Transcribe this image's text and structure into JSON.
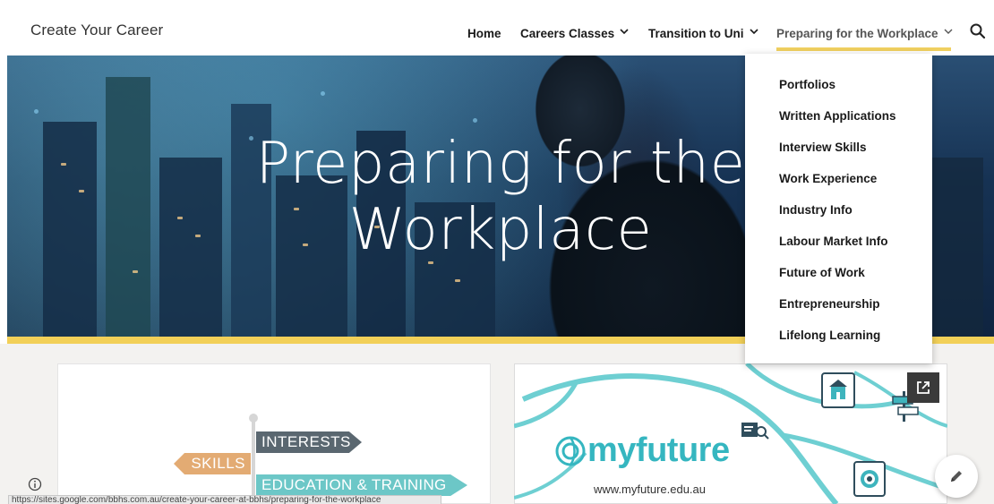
{
  "header": {
    "site_title": "Create Your Career",
    "nav": {
      "home": "Home",
      "careers_classes": "Careers Classes",
      "transition_to_uni": "Transition to Uni",
      "preparing_for_workplace": "Preparing for the Workplace"
    }
  },
  "hero": {
    "title_line1": "Preparing for the",
    "title_line2": "Workplace"
  },
  "dropdown": {
    "items": [
      "Portfolios",
      "Written Applications",
      "Interview Skills",
      "Work Experience",
      "Industry Info",
      "Labour Market Info",
      "Future of Work",
      "Entrepreneurship",
      "Lifelong Learning"
    ]
  },
  "left_card": {
    "sign_interests": "INTERESTS",
    "sign_skills": "SKILLS",
    "sign_education": "EDUCATION & TRAINING"
  },
  "right_card": {
    "logo_text": "myfuture",
    "url": "www.myfuture.edu.au"
  },
  "status_bar": {
    "url": "https://sites.google.com/bbhs.com.au/create-your-career-at-bbhs/preparing-for-the-workplace"
  },
  "colors": {
    "accent_yellow": "#f2d058",
    "teal": "#35b6c0",
    "hero_blue": "#163253"
  },
  "icons": {
    "search": "search-icon",
    "chevron": "chevron-down-icon",
    "external_link": "external-link-icon",
    "info": "info-icon",
    "edit": "pencil-icon"
  }
}
